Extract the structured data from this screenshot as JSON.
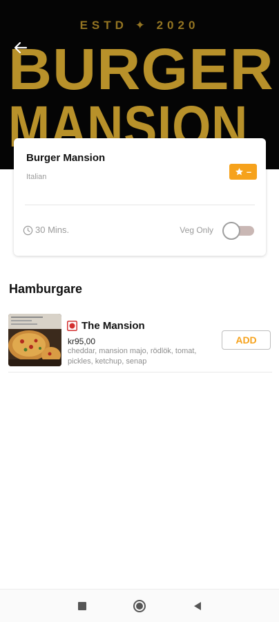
{
  "hero": {
    "estd_text": "ESTD ✦ 2020",
    "logo_line1": "BURGER",
    "logo_line2": "MANSION"
  },
  "restaurant": {
    "name": "Burger Mansion",
    "cuisine": "Italian",
    "rating": "–",
    "delivery_time": "30 Mins.",
    "veg_only_label": "Veg Only",
    "veg_only_enabled": false
  },
  "menu": {
    "section_title": "Hamburgare",
    "items": [
      {
        "name": "The Mansion",
        "price": "kr95,00",
        "description": "cheddar, mansion majo, rödlök, tomat, pickles, ketchup, senap",
        "add_label": "ADD",
        "veg_indicator": "non-veg"
      }
    ]
  },
  "icons": {
    "back": "arrow-left-icon",
    "star": "star-icon",
    "clock": "clock-icon",
    "nav_recents": "square-icon",
    "nav_home": "circle-icon",
    "nav_back": "triangle-icon"
  },
  "colors": {
    "accent": "#f6a21c",
    "hero_gold": "#b8912a",
    "non_veg_red": "#d32f2f"
  }
}
